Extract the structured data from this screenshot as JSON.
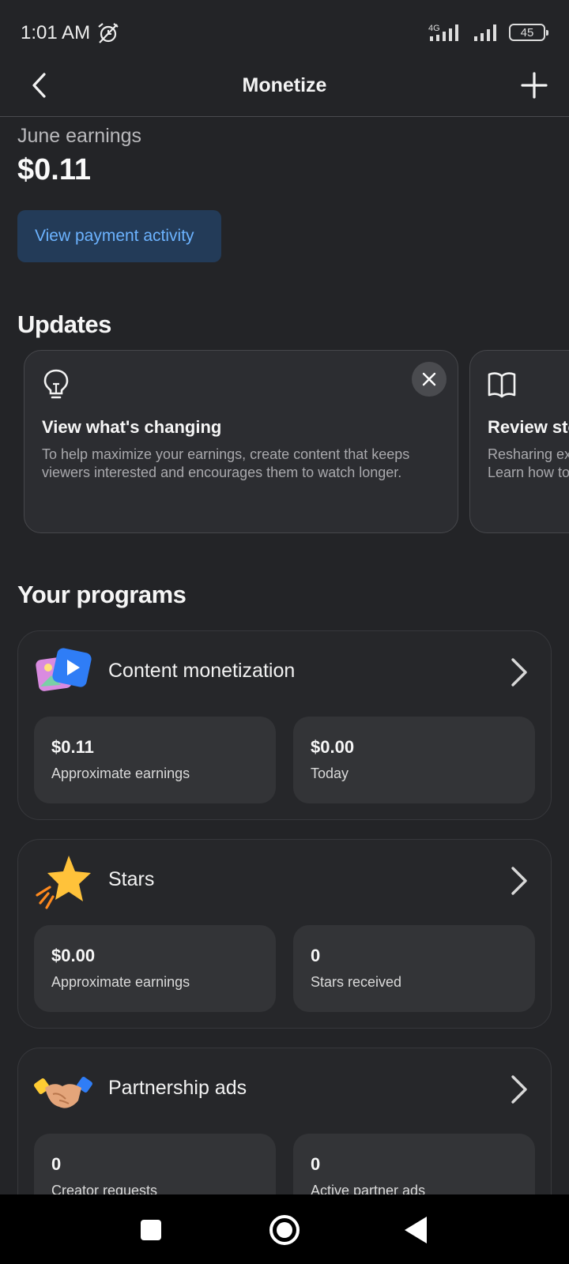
{
  "status_bar": {
    "time": "1:01 AM",
    "network": "4G",
    "battery": "45"
  },
  "header": {
    "title": "Monetize"
  },
  "earnings": {
    "label": "June earnings",
    "value": "$0.11",
    "payment_button": "View payment activity"
  },
  "updates": {
    "title": "Updates",
    "cards": [
      {
        "title": "View what's changing",
        "body_line1": "To help maximize your earnings, create content that keeps",
        "body_line2": "viewers interested and encourages them to watch longer.",
        "icon": "lightbulb-icon"
      },
      {
        "title": "Review sto",
        "body_line1": "Resharing ex",
        "body_line2": "Learn how to",
        "icon": "book-icon"
      }
    ]
  },
  "programs": {
    "title": "Your programs",
    "items": [
      {
        "name": "Content monetization",
        "icon": "content-monetization-icon",
        "stats": [
          {
            "value": "$0.11",
            "label": "Approximate earnings"
          },
          {
            "value": "$0.00",
            "label": "Today"
          }
        ]
      },
      {
        "name": "Stars",
        "icon": "star-icon",
        "stats": [
          {
            "value": "$0.00",
            "label": "Approximate earnings"
          },
          {
            "value": "0",
            "label": "Stars received"
          }
        ]
      },
      {
        "name": "Partnership ads",
        "icon": "handshake-icon",
        "stats": [
          {
            "value": "0",
            "label": "Creator requests"
          },
          {
            "value": "0",
            "label": "Active partner ads"
          }
        ]
      }
    ]
  },
  "colors": {
    "background": "#232427",
    "accent_link": "#6cb3ff",
    "button_bg": "#233b58"
  }
}
